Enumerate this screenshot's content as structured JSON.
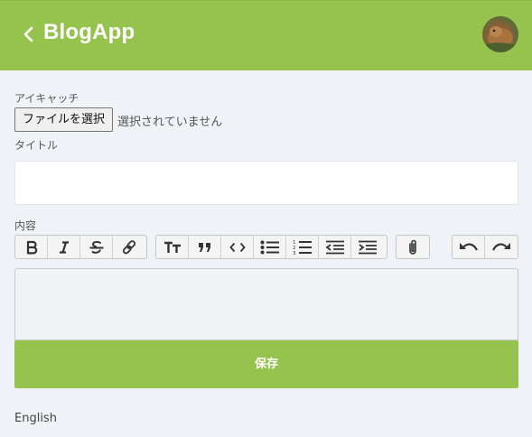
{
  "header": {
    "title": "BlogApp",
    "back_icon": "chevron-left-icon",
    "avatar_icon": "user-avatar"
  },
  "form": {
    "eyecatch_label": "アイキャッチ",
    "file_button_label": "ファイルを選択",
    "file_status": "選択されていません",
    "title_label": "タイトル",
    "title_value": "",
    "content_label": "内容",
    "content_value": ""
  },
  "toolbar": {
    "groups": [
      [
        "bold-icon",
        "italic-icon",
        "strikethrough-icon",
        "link-icon"
      ],
      [
        "heading-icon",
        "quote-icon",
        "code-icon",
        "bullet-list-icon",
        "numbered-list-icon",
        "outdent-icon",
        "indent-icon"
      ],
      [
        "attach-icon"
      ],
      [
        "undo-icon",
        "redo-icon"
      ]
    ]
  },
  "actions": {
    "save_label": "保存"
  },
  "footer": {
    "language_label": "English"
  },
  "colors": {
    "brand": "#96c34d",
    "background": "#eff3f7"
  }
}
